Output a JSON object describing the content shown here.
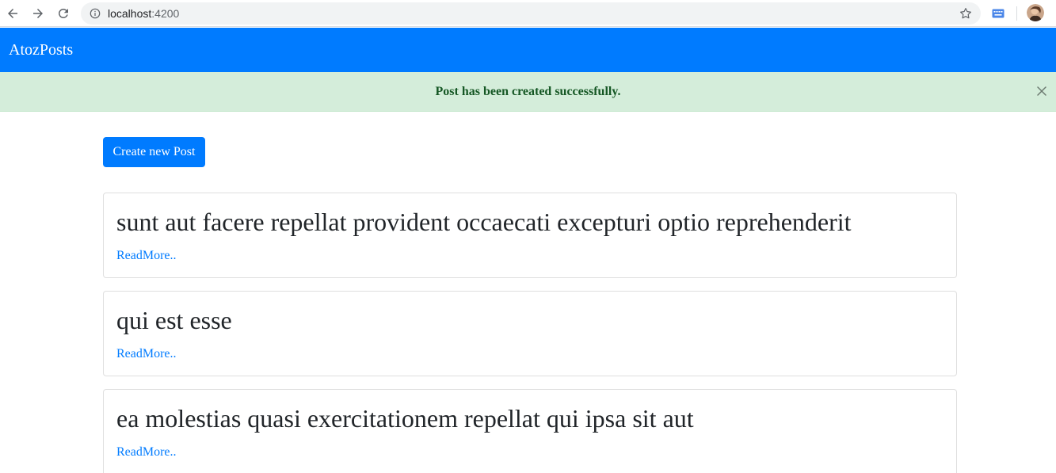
{
  "browser": {
    "url_host": "localhost",
    "url_port": ":4200"
  },
  "navbar": {
    "brand": "AtozPosts",
    "color": "#007bff"
  },
  "alert": {
    "message": "Post has been created successfully.",
    "color": "#d4edda"
  },
  "actions": {
    "create_label": "Create new Post"
  },
  "posts": [
    {
      "title": "sunt aut facere repellat provident occaecati excepturi optio reprehenderit",
      "link": "ReadMore.."
    },
    {
      "title": "qui est esse",
      "link": "ReadMore.."
    },
    {
      "title": "ea molestias quasi exercitationem repellat qui ipsa sit aut",
      "link": "ReadMore.."
    }
  ]
}
